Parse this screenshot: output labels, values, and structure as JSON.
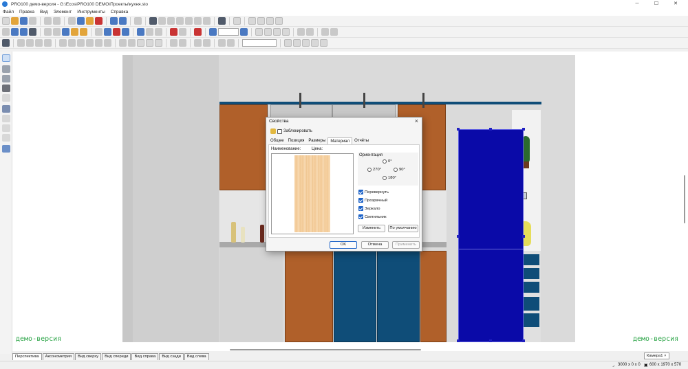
{
  "window": {
    "title": "PRO100 демо-версия - G:\\Ecos\\PRO100 DEMO\\Проекты\\кухня.sto"
  },
  "menu": [
    "Файл",
    "Правка",
    "Вид",
    "Элемент",
    "Инструменты",
    "Справка"
  ],
  "toolbar": {
    "zoom_value": "",
    "combo_value": ""
  },
  "watermark": "демо-версия",
  "view_tabs": [
    "Перспектива",
    "Аксонометрия",
    "Вид сверху",
    "Вид спереди",
    "Вид справа",
    "Вид сзади",
    "Вид слева"
  ],
  "camera_tab": "Камера1",
  "status": {
    "room_size": "3000 x 0 x 0",
    "element_size": "600 x 1970 x 570"
  },
  "dialog": {
    "title": "Свойства",
    "lock_label": "Заблокировать",
    "tabs": [
      "Общее",
      "Позиция",
      "Размеры",
      "Материал",
      "Отчёты"
    ],
    "active_tab": "Материал",
    "name_label": "Наименование:",
    "price_label": "Цена:",
    "orientation_label": "Ориентация",
    "orient_0": "0°",
    "orient_270": "270°",
    "orient_90": "90°",
    "orient_180": "180°",
    "options": [
      {
        "label": "Перевернуть",
        "checked": true
      },
      {
        "label": "Прозрачный",
        "checked": true
      },
      {
        "label": "Зеркало",
        "checked": true
      },
      {
        "label": "Светильник",
        "checked": true
      }
    ],
    "change_button": "Изменить",
    "default_button": "По умолчанию",
    "ok_button": "OK",
    "cancel_button": "Отмена",
    "apply_button": "Применить"
  },
  "colors": {
    "selected_panel": "#0a0aa8",
    "teal_door": "#0f4d78",
    "wood_door": "#b0602a",
    "watermark": "#2fa64a"
  }
}
